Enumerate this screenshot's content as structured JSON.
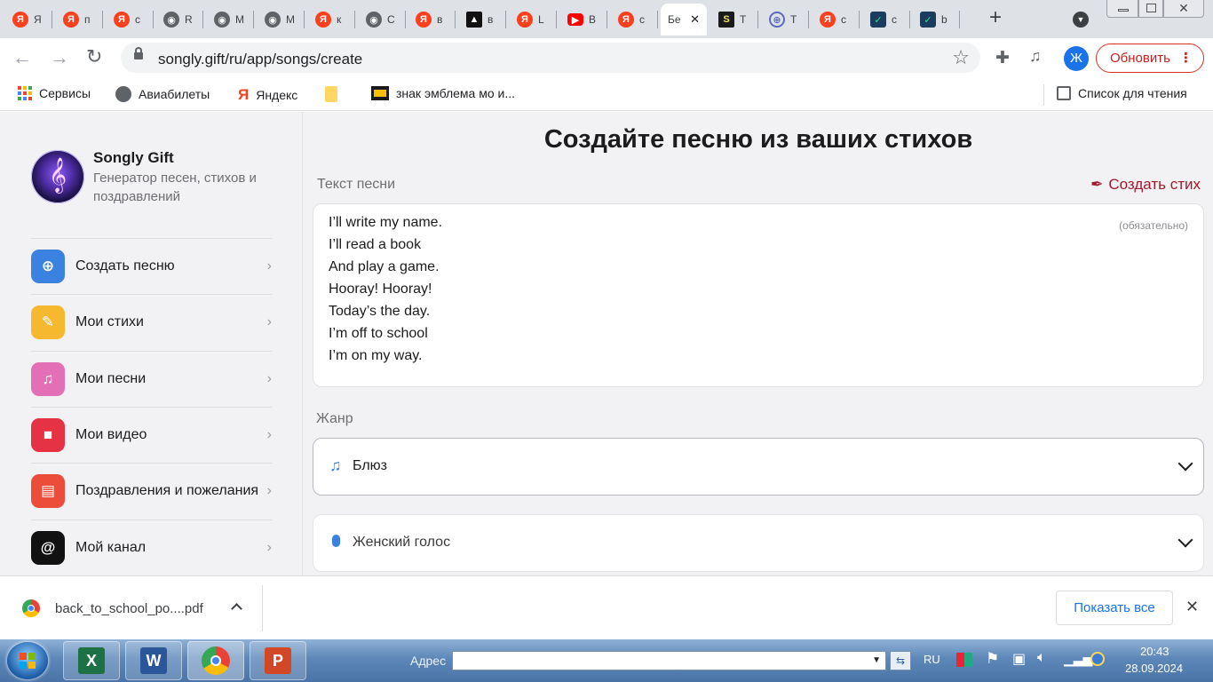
{
  "browser": {
    "tabs": [
      {
        "icon": "yandex-icon",
        "label": "Я"
      },
      {
        "icon": "yandex-icon",
        "label": "п"
      },
      {
        "icon": "yandex-icon",
        "label": "с"
      },
      {
        "icon": "globe-icon",
        "label": "R"
      },
      {
        "icon": "globe-icon",
        "label": "M"
      },
      {
        "icon": "globe-icon",
        "label": "M"
      },
      {
        "icon": "yandex-icon",
        "label": "к"
      },
      {
        "icon": "globe-icon",
        "label": "С"
      },
      {
        "icon": "yandex-icon",
        "label": "в"
      },
      {
        "icon": "image-icon",
        "label": "в"
      },
      {
        "icon": "yandex-icon",
        "label": "L"
      },
      {
        "icon": "youtube-icon",
        "label": "B"
      },
      {
        "icon": "yandex-icon",
        "label": "с"
      },
      {
        "icon": "songly-icon",
        "label": "Бе",
        "active": true
      },
      {
        "icon": "s-icon",
        "label": "T"
      },
      {
        "icon": "www-icon",
        "label": "T"
      },
      {
        "icon": "yandex-icon",
        "label": "с"
      },
      {
        "icon": "check-icon",
        "label": "с"
      },
      {
        "icon": "check-icon",
        "label": "b"
      }
    ],
    "url": "songly.gift/ru/app/songs/create",
    "update_button": "Обновить",
    "profile_initial": "Ж",
    "bookmarks": [
      "Сервисы",
      "Авиабилеты",
      "Яндекс",
      "",
      "знак эмблема мо и..."
    ],
    "reading_list": "Список для чтения"
  },
  "sidebar": {
    "app_name": "Songly Gift",
    "app_desc": "Генератор песен, стихов и поздравлений",
    "items": [
      {
        "label": "Создать песню",
        "icon": "plus-icon",
        "color": "#3b82e0"
      },
      {
        "label": "Мои стихи",
        "icon": "feather-icon",
        "color": "#f5b82e"
      },
      {
        "label": "Мои песни",
        "icon": "music-note-icon",
        "color": "#e36fb6"
      },
      {
        "label": "Мои видео",
        "icon": "video-icon",
        "color": "#e53244"
      },
      {
        "label": "Поздравления и пожелания",
        "icon": "document-icon",
        "color": "#ec4d3a"
      },
      {
        "label": "Мой канал",
        "icon": "at-icon",
        "color": "#111111"
      }
    ]
  },
  "main": {
    "title": "Создайте песню из ваших стихов",
    "lyrics_label": "Текст песни",
    "create_poem_link": "Создать стих",
    "required_hint": "(обязательно)",
    "lyrics": [
      "I’ll write my name.",
      "I’ll read a book",
      "And play a game.",
      "Hooray! Hooray!",
      "Today’s the day.",
      "I’m off to school",
      "I’m on my way."
    ],
    "genre_label": "Жанр",
    "genre_value": "Блюз",
    "voice_value": "Женский голос"
  },
  "download": {
    "filename": "back_to_school_po....pdf",
    "show_all": "Показать все"
  },
  "taskbar": {
    "address_label": "Адрес",
    "lang": "RU",
    "time": "20:43",
    "date": "28.09.2024"
  }
}
